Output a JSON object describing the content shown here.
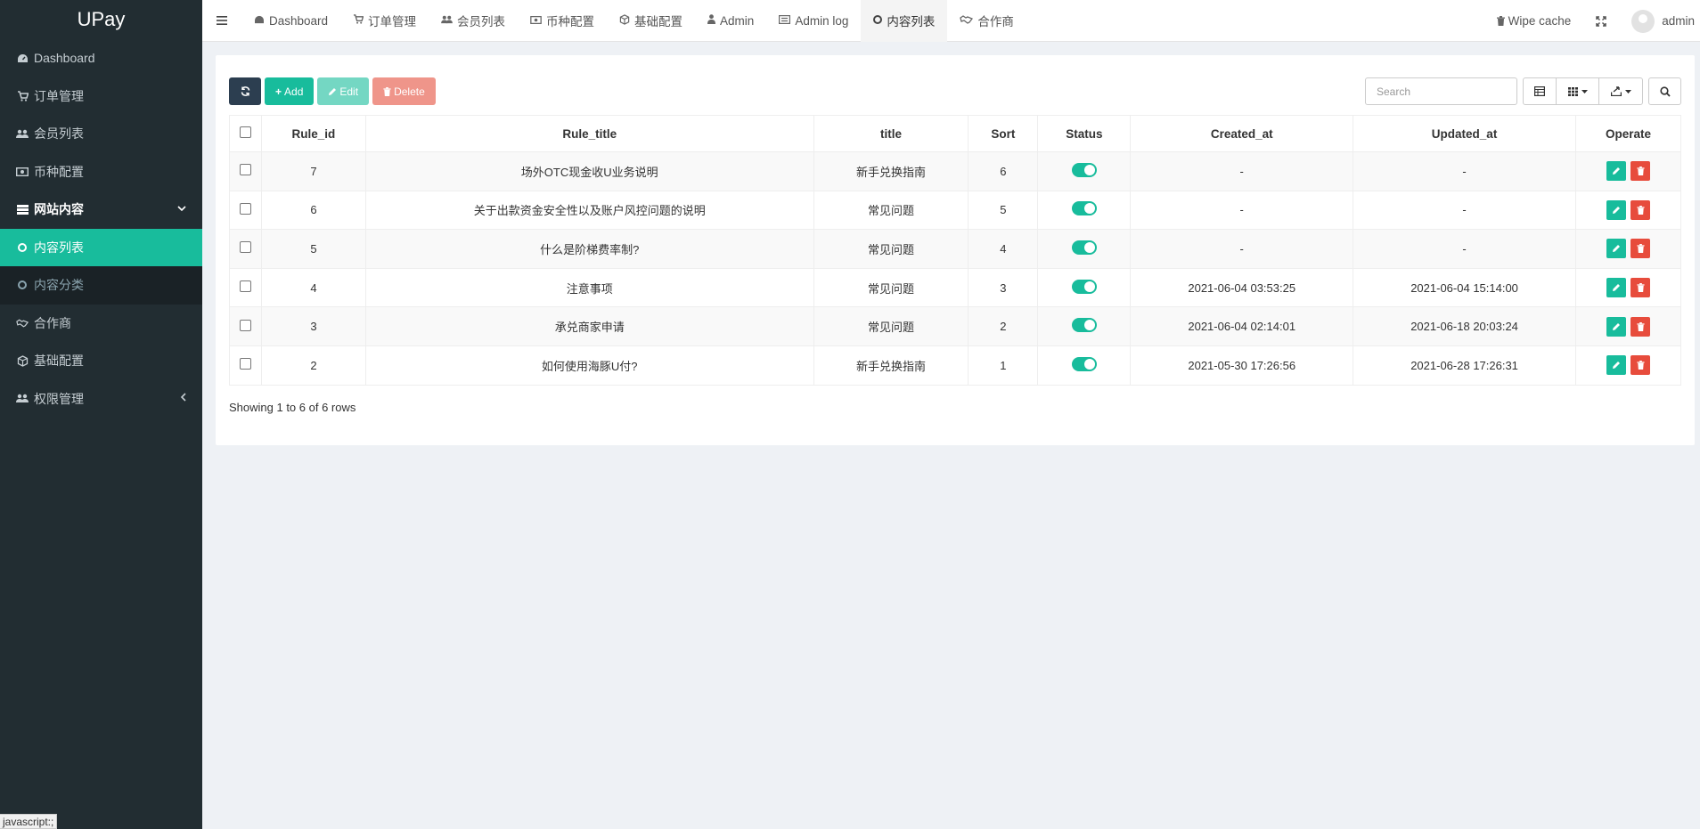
{
  "app": {
    "logo": "UPay"
  },
  "sidebar": {
    "items": [
      {
        "label": "Dashboard",
        "icon": "dashboard-icon"
      },
      {
        "label": "订单管理",
        "icon": "cart-icon"
      },
      {
        "label": "会员列表",
        "icon": "users-icon"
      },
      {
        "label": "币种配置",
        "icon": "money-icon"
      },
      {
        "label": "网站内容",
        "icon": "list-icon"
      },
      {
        "label": "内容列表",
        "icon": "circle-icon"
      },
      {
        "label": "内容分类",
        "icon": "circle-icon"
      },
      {
        "label": "合作商",
        "icon": "handshake-icon"
      },
      {
        "label": "基础配置",
        "icon": "cube-icon"
      },
      {
        "label": "权限管理",
        "icon": "group-icon"
      }
    ]
  },
  "topnav": {
    "tabs": [
      {
        "label": "Dashboard"
      },
      {
        "label": "订单管理"
      },
      {
        "label": "会员列表"
      },
      {
        "label": "币种配置"
      },
      {
        "label": "基础配置"
      },
      {
        "label": "Admin"
      },
      {
        "label": "Admin log"
      },
      {
        "label": "内容列表"
      },
      {
        "label": "合作商"
      }
    ],
    "wipe_cache": "Wipe cache",
    "user": "admin"
  },
  "toolbar": {
    "add": "Add",
    "edit": "Edit",
    "delete": "Delete",
    "search_placeholder": "Search"
  },
  "table": {
    "columns": [
      "Rule_id",
      "Rule_title",
      "title",
      "Sort",
      "Status",
      "Created_at",
      "Updated_at",
      "Operate"
    ],
    "rows": [
      {
        "id": "7",
        "rule_title": "场外OTC现金收U业务说明",
        "title": "新手兑换指南",
        "sort": "6",
        "created": "-",
        "updated": "-"
      },
      {
        "id": "6",
        "rule_title": "关于出款资金安全性以及账户风控问题的说明",
        "title": "常见问题",
        "sort": "5",
        "created": "-",
        "updated": "-"
      },
      {
        "id": "5",
        "rule_title": "什么是阶梯费率制?",
        "title": "常见问题",
        "sort": "4",
        "created": "-",
        "updated": "-"
      },
      {
        "id": "4",
        "rule_title": "注意事项",
        "title": "常见问题",
        "sort": "3",
        "created": "2021-06-04 03:53:25",
        "updated": "2021-06-04 15:14:00"
      },
      {
        "id": "3",
        "rule_title": "承兑商家申请",
        "title": "常见问题",
        "sort": "2",
        "created": "2021-06-04 02:14:01",
        "updated": "2021-06-18 20:03:24"
      },
      {
        "id": "2",
        "rule_title": "如何使用海豚U付?",
        "title": "新手兑换指南",
        "sort": "1",
        "created": "2021-05-30 17:26:56",
        "updated": "2021-06-28 17:26:31"
      }
    ]
  },
  "pagination": {
    "summary": "Showing 1 to 6 of 6 rows"
  },
  "statusbar": {
    "text": "javascript:;"
  },
  "colors": {
    "accent": "#18bc9c",
    "danger": "#e74c3c",
    "sidebar": "#222d32",
    "dark": "#2c3e50"
  }
}
